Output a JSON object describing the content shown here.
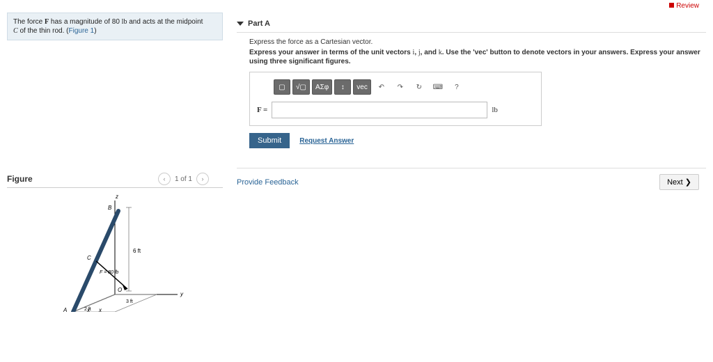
{
  "header": {
    "review": "Review"
  },
  "problem": {
    "text_pre": "The force ",
    "F": "F",
    "text_mid1": " has a magnitude of 80 ",
    "lb": "lb",
    "text_mid2": " and acts at the midpoint ",
    "C": "C",
    "text_post": " of the thin rod. (",
    "fig_link": "Figure 1",
    "text_close": ")"
  },
  "figure": {
    "title": "Figure",
    "page": "1 of 1",
    "labels": {
      "z": "z",
      "B": "B",
      "C": "C",
      "A": "A",
      "O": "O",
      "y": "y",
      "x": "x",
      "six_ft": "6 ft",
      "three_ft": "3 ft",
      "two_ft": "2 ft",
      "F80": "F = 80 lb"
    }
  },
  "part": {
    "title": "Part A",
    "instruction1": "Express the force as a Cartesian vector.",
    "instr2_pre": "Express your answer in terms of the unit vectors ",
    "i": "i",
    "j": "j",
    "and": ", and ",
    "k": "k",
    "instr2_post": ". Use the 'vec' button to denote vectors in your answers. Express your answer using three significant figures.",
    "toolbar": {
      "templates": "▢",
      "root": "√▢",
      "greek": "ΑΣφ",
      "subsup": "↕",
      "vec": "vec",
      "undo": "↶",
      "redo": "↷",
      "reset": "↻",
      "keyboard": "⌨",
      "help": "?"
    },
    "answer_label": "F =",
    "unit": "lb",
    "submit": "Submit",
    "request": "Request Answer"
  },
  "footer": {
    "feedback": "Provide Feedback",
    "next": "Next ❯"
  }
}
